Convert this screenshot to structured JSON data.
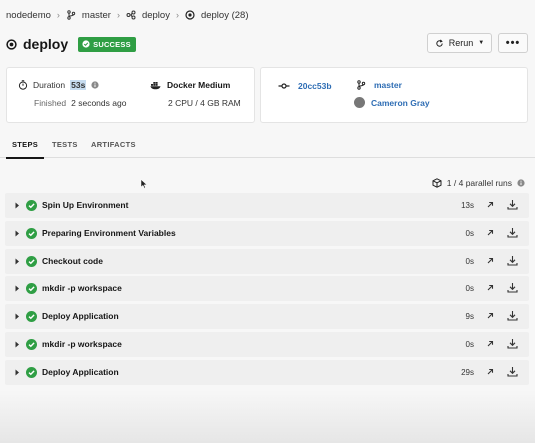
{
  "breadcrumb": {
    "project": "nodedemo",
    "branch": "master",
    "workflow": "deploy",
    "job": "deploy (28)"
  },
  "header": {
    "title": "deploy",
    "status": "SUCCESS",
    "status_color": "#2f9e44",
    "rerun_label": "Rerun",
    "more_label": "•••"
  },
  "summary": {
    "duration_label": "Duration",
    "duration_value": "53s",
    "finished_label": "Finished",
    "finished_value": "2 seconds ago",
    "executor": "Docker Medium",
    "resources": "2 CPU / 4 GB RAM",
    "commit": "20cc53b",
    "branch": "master",
    "author": "Cameron Gray"
  },
  "tabs": [
    {
      "label": "STEPS",
      "active": true
    },
    {
      "label": "TESTS",
      "active": false
    },
    {
      "label": "ARTIFACTS",
      "active": false
    }
  ],
  "parallel_runs": "1 / 4 parallel runs",
  "steps": [
    {
      "name": "Spin Up Environment",
      "duration": "13s"
    },
    {
      "name": "Preparing Environment Variables",
      "duration": "0s"
    },
    {
      "name": "Checkout code",
      "duration": "0s"
    },
    {
      "name": "mkdir -p workspace",
      "duration": "0s"
    },
    {
      "name": "Deploy Application",
      "duration": "9s"
    },
    {
      "name": "mkdir -p workspace",
      "duration": "0s"
    },
    {
      "name": "Deploy Application",
      "duration": "29s"
    }
  ],
  "colors": {
    "link": "#2e6db4",
    "success": "#2f9e44",
    "highlight": "#c7dcef"
  }
}
